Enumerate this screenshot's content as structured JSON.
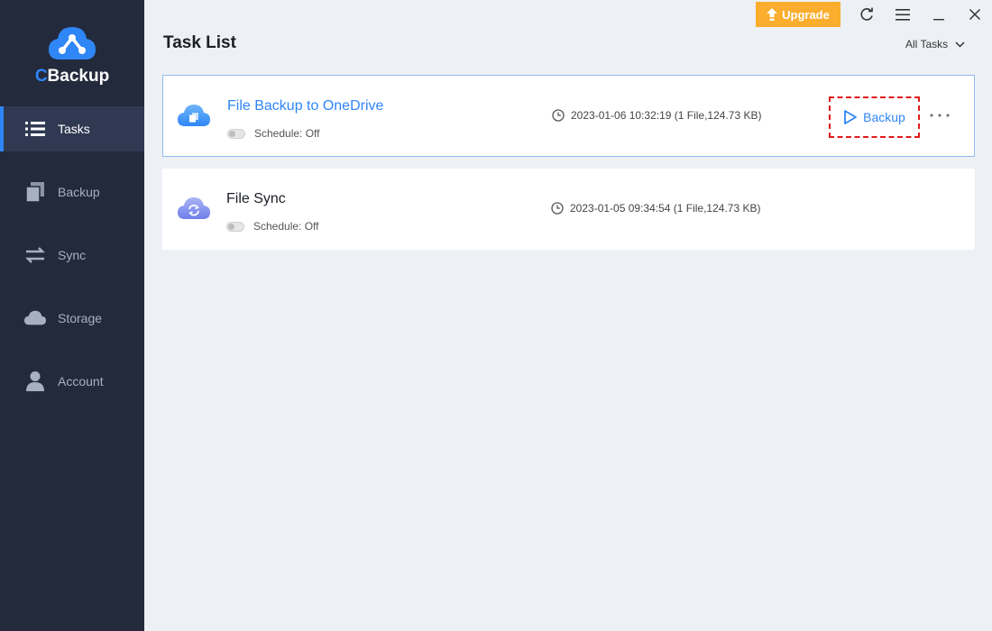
{
  "app": {
    "brand_c": "C",
    "brand_rest": "Backup",
    "accent": "#2f86f6",
    "sidebar_bg": "#232a3b"
  },
  "sidebar": {
    "items": [
      {
        "label": "Tasks",
        "icon": "list-icon",
        "active": true
      },
      {
        "label": "Backup",
        "icon": "backup-copy-icon",
        "active": false
      },
      {
        "label": "Sync",
        "icon": "sync-arrows-icon",
        "active": false
      },
      {
        "label": "Storage",
        "icon": "cloud-icon",
        "active": false
      },
      {
        "label": "Account",
        "icon": "user-icon",
        "active": false
      }
    ]
  },
  "titlebar": {
    "upgrade_label": "Upgrade",
    "upgrade_color": "#fbad2d"
  },
  "header": {
    "title": "Task List",
    "filter_label": "All Tasks"
  },
  "tasks": [
    {
      "name": "File Backup to OneDrive",
      "schedule": "Schedule: Off",
      "last_run": "2023-01-06 10:32:19 (1 File,124.73 KB)",
      "action_label": "Backup"
    },
    {
      "name": "File Sync",
      "schedule": "Schedule: Off",
      "last_run": "2023-01-05 09:34:54 (1 File,124.73 KB)"
    }
  ]
}
